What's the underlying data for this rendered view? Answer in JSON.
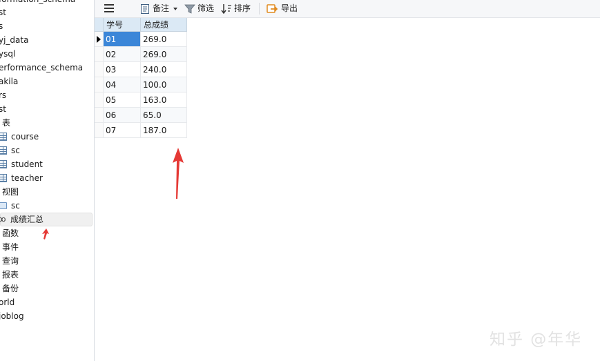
{
  "sidebar": {
    "items": [
      {
        "label": "formation_schema"
      },
      {
        "label": "st"
      },
      {
        "label": "s"
      },
      {
        "label": "yj_data"
      },
      {
        "label": "ysql"
      },
      {
        "label": "erformance_schema"
      },
      {
        "label": "akila"
      },
      {
        "label": "rs"
      },
      {
        "label": "st"
      },
      {
        "label": "表"
      },
      {
        "label": "course",
        "icon": "table-icon"
      },
      {
        "label": "sc",
        "icon": "table-icon"
      },
      {
        "label": "student",
        "icon": "table-icon"
      },
      {
        "label": "teacher",
        "icon": "table-icon"
      },
      {
        "label": "视图"
      },
      {
        "label": "sc",
        "icon": "view-folder-icon"
      },
      {
        "label": "成绩汇总",
        "icon": "query-icon",
        "selected": true
      },
      {
        "label": "函数"
      },
      {
        "label": "事件"
      },
      {
        "label": "查询"
      },
      {
        "label": "报表"
      },
      {
        "label": "备份"
      },
      {
        "label": "orld"
      },
      {
        "label": "joblog"
      }
    ],
    "query_icon_glyph": "oo"
  },
  "toolbar": {
    "menu_icon": "hamburger-menu-icon",
    "note_label": "备注",
    "filter_label": "筛选",
    "sort_label": "排序",
    "export_label": "导出"
  },
  "grid": {
    "columns": [
      "学号",
      "总成绩"
    ],
    "rows": [
      [
        "01",
        "269.0"
      ],
      [
        "02",
        "269.0"
      ],
      [
        "03",
        "240.0"
      ],
      [
        "04",
        "100.0"
      ],
      [
        "05",
        "163.0"
      ],
      [
        "06",
        "65.0"
      ],
      [
        "07",
        "187.0"
      ]
    ],
    "active_row": 0
  },
  "annotations": {
    "arrow_color": "#e53935"
  },
  "watermark": {
    "text": "知乎 @年华"
  },
  "colors": {
    "selection": "#3b86d8",
    "header_bg": "#dbe9f5"
  }
}
